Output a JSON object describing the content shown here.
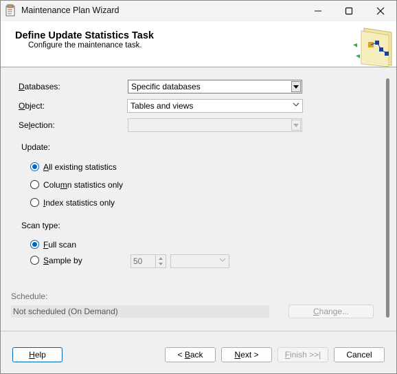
{
  "window": {
    "title": "Maintenance Plan Wizard"
  },
  "header": {
    "title": "Define Update Statistics Task",
    "subtitle": "Configure the maintenance task."
  },
  "form": {
    "databases": {
      "label_u": "D",
      "label_rest": "atabases:",
      "value": "Specific databases"
    },
    "object": {
      "label_u": "O",
      "label_rest": "bject:",
      "value": "Tables and views"
    },
    "selection": {
      "label_pre": "Se",
      "label_u": "l",
      "label_rest": "ection:",
      "value": ""
    }
  },
  "update": {
    "label": "Update:",
    "options": [
      {
        "u": "A",
        "rest": "ll existing statistics",
        "selected": true
      },
      {
        "pre": "Colu",
        "u": "m",
        "rest": "n statistics only",
        "selected": false
      },
      {
        "u": "I",
        "rest": "ndex statistics only",
        "selected": false
      }
    ]
  },
  "scan": {
    "label": "Scan type:",
    "full": {
      "u": "F",
      "rest": "ull scan",
      "selected": true
    },
    "sample": {
      "u": "S",
      "rest": "ample by",
      "selected": false,
      "value": "50",
      "unit": ""
    }
  },
  "schedule": {
    "label": "Schedule:",
    "value": "Not scheduled (On Demand)",
    "change_u": "C",
    "change_rest": "hange..."
  },
  "buttons": {
    "help": {
      "u": "H",
      "rest": "elp"
    },
    "back": {
      "pre": "< ",
      "u": "B",
      "rest": "ack"
    },
    "next": {
      "u": "N",
      "rest": "ext >"
    },
    "finish": {
      "u": "F",
      "rest": "inish >>|"
    },
    "cancel": "Cancel"
  }
}
